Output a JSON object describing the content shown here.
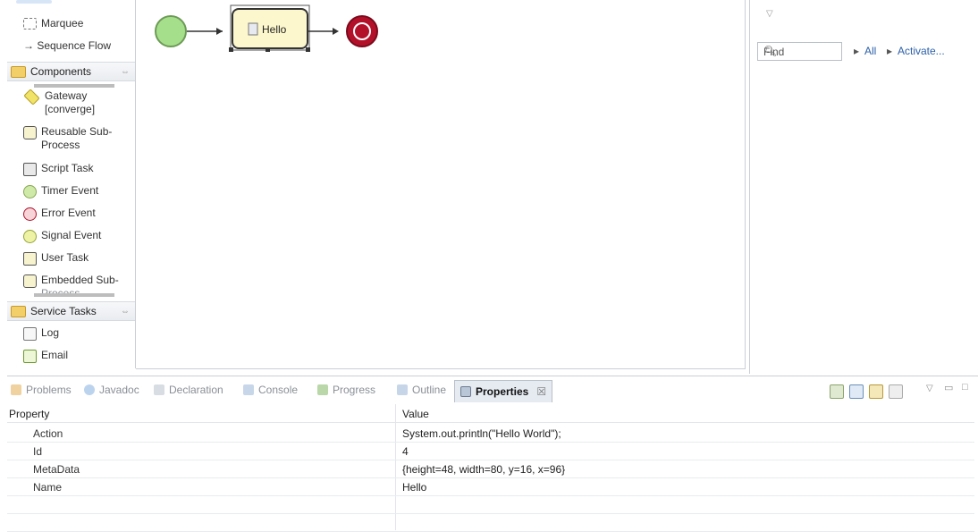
{
  "palette": {
    "items_top": [
      {
        "label": "Marquee",
        "icon": "marquee-icon"
      },
      {
        "label": "→ Sequence Flow",
        "icon": "arrow-icon"
      }
    ],
    "drawers": {
      "components": "Components",
      "service_tasks": "Service Tasks"
    },
    "components": [
      {
        "label": "Gateway [converge]",
        "line1": "Gateway",
        "line2": "[converge]"
      },
      {
        "label": "Reusable Sub-Process",
        "line1": "Reusable Sub-",
        "line2": "Process"
      },
      {
        "label": "Script Task"
      },
      {
        "label": "Timer Event"
      },
      {
        "label": "Error Event"
      },
      {
        "label": "Signal Event"
      },
      {
        "label": "User Task"
      },
      {
        "label": "Embedded Sub-Process",
        "line1": "Embedded Sub-",
        "line2": "Process"
      }
    ],
    "service_tasks": [
      {
        "label": "Log"
      },
      {
        "label": "Email"
      }
    ]
  },
  "diagram": {
    "task_label": "Hello"
  },
  "right_panel": {
    "find_placeholder": "Find",
    "all_link": "All",
    "activate_link": "Activate..."
  },
  "bottom_tabs": [
    {
      "label": "Problems"
    },
    {
      "label": "Javadoc"
    },
    {
      "label": "Declaration"
    },
    {
      "label": "Console"
    },
    {
      "label": "Progress"
    },
    {
      "label": "Outline"
    },
    {
      "label": "Properties",
      "active": true,
      "close": "☒"
    }
  ],
  "properties": {
    "col_property": "Property",
    "col_value": "Value",
    "rows": [
      {
        "key": "Action",
        "value": "System.out.println(\"Hello World\");"
      },
      {
        "key": "Id",
        "value": "4"
      },
      {
        "key": "MetaData",
        "value": "{height=48, width=80, y=16, x=96}"
      },
      {
        "key": "Name",
        "value": "Hello"
      }
    ]
  },
  "colors": {
    "start_event": "#a6df8c",
    "end_event": "#b3112a",
    "task_fill": "#fcf7cc",
    "tab_active": "#e6ebf2"
  }
}
